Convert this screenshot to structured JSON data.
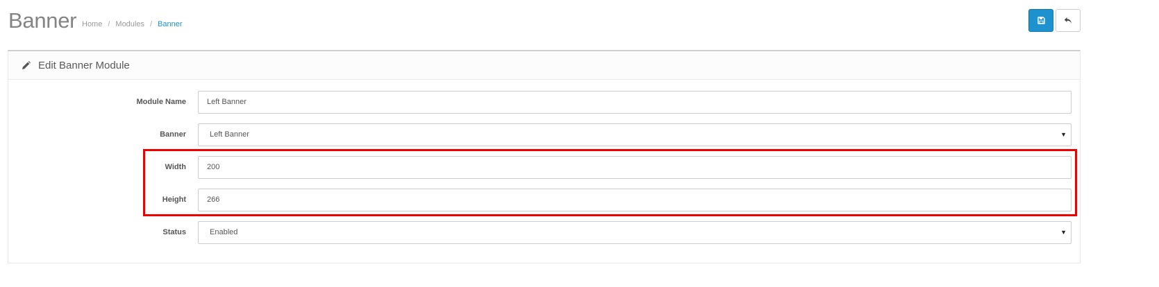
{
  "header": {
    "title": "Banner",
    "breadcrumb": [
      {
        "label": "Home",
        "active": false
      },
      {
        "label": "Modules",
        "active": false
      },
      {
        "label": "Banner",
        "active": true
      }
    ],
    "separator": "/",
    "save_icon": "save-icon",
    "back_icon": "reply-icon"
  },
  "panel": {
    "title": "Edit Banner Module",
    "icon": "pencil-icon"
  },
  "form": {
    "module_name": {
      "label": "Module Name",
      "value": "Left Banner"
    },
    "banner": {
      "label": "Banner",
      "value": "Left Banner"
    },
    "width": {
      "label": "Width",
      "value": "200"
    },
    "height": {
      "label": "Height",
      "value": "266"
    },
    "status": {
      "label": "Status",
      "value": "Enabled"
    }
  },
  "colors": {
    "primary": "#1e91cf",
    "highlight": "#ee0000"
  }
}
